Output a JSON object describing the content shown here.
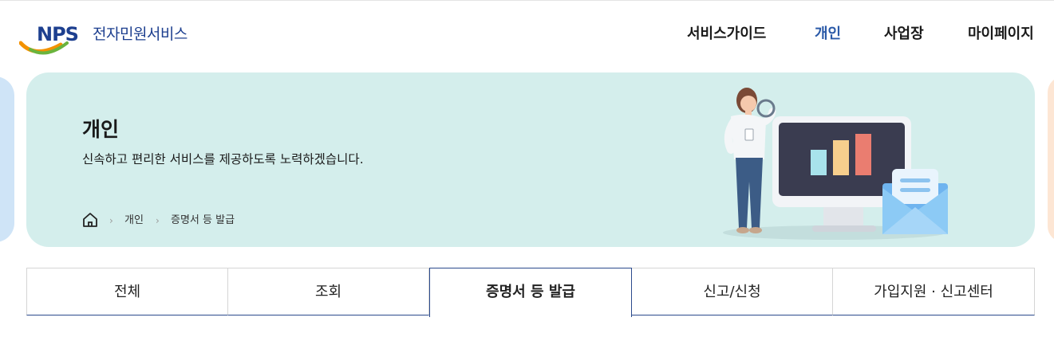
{
  "header": {
    "logo_abbr": "NPS",
    "logo_text": "전자민원서비스",
    "nav": [
      {
        "label": "서비스가이드",
        "active": false
      },
      {
        "label": "개인",
        "active": true
      },
      {
        "label": "사업장",
        "active": false
      },
      {
        "label": "마이페이지",
        "active": false
      }
    ]
  },
  "banner": {
    "title": "개인",
    "subtitle": "신속하고 편리한 서비스를 제공하도록 노력하겠습니다.",
    "breadcrumb": {
      "home_icon": "home-icon",
      "separator_icon": "chevron-right-icon",
      "items": [
        "개인",
        "증명서 등 발급"
      ]
    }
  },
  "tabs": [
    {
      "label": "전체",
      "active": false
    },
    {
      "label": "조회",
      "active": false
    },
    {
      "label": "증명서 등 발급",
      "active": true
    },
    {
      "label": "신고/신청",
      "active": false
    },
    {
      "label": "가입지원 · 신고센터",
      "active": false
    }
  ],
  "colors": {
    "brand_blue": "#1d3f8f",
    "nav_active": "#2b5aa8",
    "banner_bg": "#d4eeec",
    "tab_active_border": "#2b4a8c"
  }
}
